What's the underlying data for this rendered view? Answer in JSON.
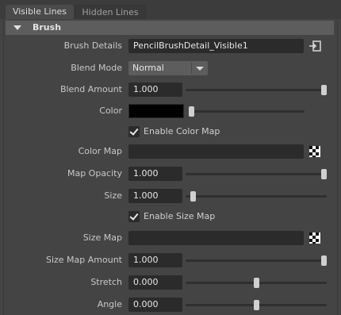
{
  "tabs": [
    {
      "label": "Visible Lines",
      "active": true
    },
    {
      "label": "Hidden Lines",
      "active": false
    }
  ],
  "section": {
    "title": "Brush"
  },
  "fields": {
    "brush_details": {
      "label": "Brush Details",
      "value": "PencilBrushDetail_Visible1",
      "icon": "input-connection-icon"
    },
    "blend_mode": {
      "label": "Blend Mode",
      "value": "Normal"
    },
    "blend_amount": {
      "label": "Blend Amount",
      "value": "1.000",
      "slider": 1.0
    },
    "color": {
      "label": "Color",
      "swatch": "#000000",
      "slider": 0.0
    },
    "enable_color_map": {
      "label": "Enable Color Map",
      "checked": true
    },
    "color_map": {
      "label": "Color Map",
      "value": "",
      "icon": "checker-map-icon"
    },
    "map_opacity": {
      "label": "Map Opacity",
      "value": "1.000",
      "slider": 1.0
    },
    "size": {
      "label": "Size",
      "value": "1.000",
      "slider": 0.05
    },
    "enable_size_map": {
      "label": "Enable Size Map",
      "checked": true
    },
    "size_map": {
      "label": "Size Map",
      "value": "",
      "icon": "checker-map-icon"
    },
    "size_map_amount": {
      "label": "Size Map Amount",
      "value": "1.000",
      "slider": 1.0
    },
    "stretch": {
      "label": "Stretch",
      "value": "0.000",
      "slider": 0.5
    },
    "angle": {
      "label": "Angle",
      "value": "0.000",
      "slider": 0.5
    }
  },
  "colors": {
    "background": "#444444",
    "field": "#2b2b2b",
    "header": "#5d5d5d",
    "handle": "#cfcfcf"
  }
}
